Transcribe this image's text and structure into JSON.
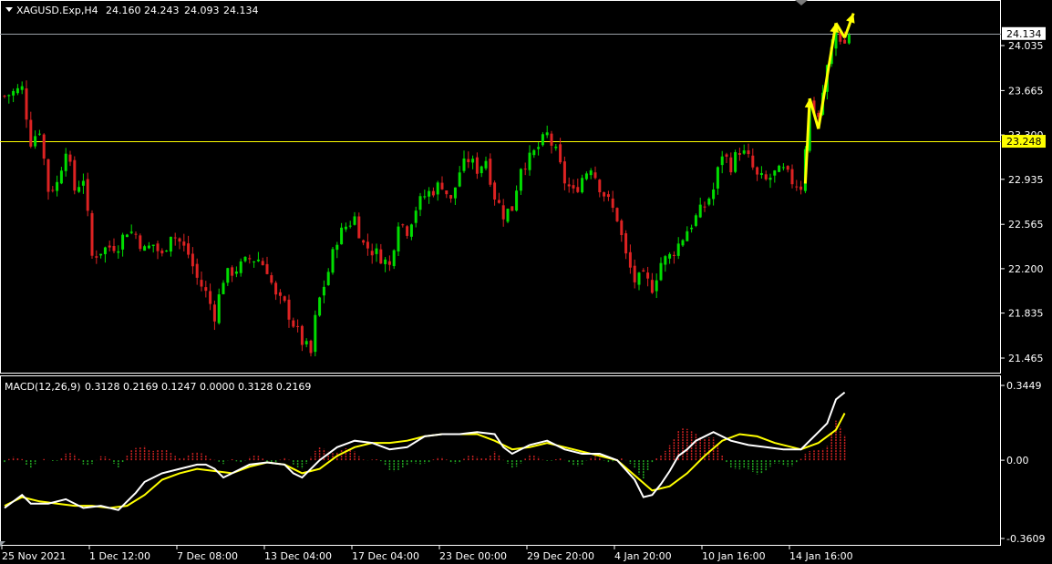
{
  "header": {
    "symbol": "XAGUSD.Exp,H4",
    "open": "24.160",
    "high": "24.243",
    "low": "24.093",
    "close": "24.134"
  },
  "macd_header": {
    "label": "MACD(12,26,9)",
    "values": "0.3128 0.2169 0.1247 0.0000 0.3128 0.2169"
  },
  "colors": {
    "background": "#000000",
    "bull": "#00dd00",
    "bear": "#dd2222",
    "frame": "#ffffff",
    "level_line": "#ffff00",
    "price_line": "#9aa0a6",
    "macd_line": "#ffffff",
    "signal_line": "#ffff00",
    "hist_pos": "#cc2222",
    "hist_neg": "#22aa22",
    "arrow": "#ffff00"
  },
  "chart_data": [
    {
      "type": "candlestick",
      "title": "XAGUSD.Exp,H4",
      "price_ticks": [
        "24.035",
        "23.665",
        "23.300",
        "22.935",
        "22.565",
        "22.200",
        "21.835",
        "21.465"
      ],
      "current_price": "24.134",
      "level": "23.248",
      "ylim": [
        21.25,
        24.5
      ],
      "x_labels": [
        "25 Nov 2021",
        "1 Dec 12:00",
        "7 Dec 08:00",
        "13 Dec 04:00",
        "17 Dec 04:00",
        "23 Dec 00:00",
        "29 Dec 20:00",
        "4 Jan 20:00",
        "10 Jan 16:00",
        "14 Jan 16:00"
      ],
      "close_path": [
        [
          0,
          23.62
        ],
        [
          4,
          23.68
        ],
        [
          6,
          23.25
        ],
        [
          8,
          23.35
        ],
        [
          10,
          22.85
        ],
        [
          12,
          22.9
        ],
        [
          14,
          23.2
        ],
        [
          16,
          22.85
        ],
        [
          18,
          22.95
        ],
        [
          20,
          22.3
        ],
        [
          22,
          22.35
        ],
        [
          24,
          22.38
        ],
        [
          26,
          22.4
        ],
        [
          28,
          22.52
        ],
        [
          30,
          22.48
        ],
        [
          32,
          22.35
        ],
        [
          34,
          22.4
        ],
        [
          36,
          22.3
        ],
        [
          38,
          22.5
        ],
        [
          40,
          22.42
        ],
        [
          42,
          22.32
        ],
        [
          44,
          22.12
        ],
        [
          46,
          22.0
        ],
        [
          48,
          21.82
        ],
        [
          50,
          22.12
        ],
        [
          52,
          22.18
        ],
        [
          54,
          22.22
        ],
        [
          56,
          22.28
        ],
        [
          58,
          22.28
        ],
        [
          60,
          22.2
        ],
        [
          62,
          21.96
        ],
        [
          64,
          21.9
        ],
        [
          66,
          21.75
        ],
        [
          68,
          21.6
        ],
        [
          70,
          21.5
        ],
        [
          71,
          21.78
        ],
        [
          72,
          21.95
        ],
        [
          74,
          22.18
        ],
        [
          76,
          22.45
        ],
        [
          78,
          22.55
        ],
        [
          80,
          22.62
        ],
        [
          82,
          22.4
        ],
        [
          84,
          22.35
        ],
        [
          86,
          22.3
        ],
        [
          88,
          22.22
        ],
        [
          90,
          22.6
        ],
        [
          92,
          22.52
        ],
        [
          94,
          22.7
        ],
        [
          96,
          22.8
        ],
        [
          98,
          22.85
        ],
        [
          100,
          22.9
        ],
        [
          102,
          22.75
        ],
        [
          104,
          23.0
        ],
        [
          106,
          23.1
        ],
        [
          108,
          23.02
        ],
        [
          110,
          23.1
        ],
        [
          112,
          22.8
        ],
        [
          114,
          22.65
        ],
        [
          116,
          22.7
        ],
        [
          118,
          23.05
        ],
        [
          120,
          23.1
        ],
        [
          122,
          23.2
        ],
        [
          124,
          23.3
        ],
        [
          126,
          23.15
        ],
        [
          128,
          22.92
        ],
        [
          130,
          22.82
        ],
        [
          132,
          22.95
        ],
        [
          134,
          23.05
        ],
        [
          136,
          22.88
        ],
        [
          138,
          22.75
        ],
        [
          140,
          22.62
        ],
        [
          142,
          22.3
        ],
        [
          144,
          22.1
        ],
        [
          146,
          22.12
        ],
        [
          148,
          22.05
        ],
        [
          150,
          22.25
        ],
        [
          152,
          22.3
        ],
        [
          154,
          22.4
        ],
        [
          156,
          22.52
        ],
        [
          158,
          22.62
        ],
        [
          160,
          22.72
        ],
        [
          162,
          22.85
        ],
        [
          164,
          23.15
        ],
        [
          166,
          23.05
        ],
        [
          168,
          23.18
        ],
        [
          170,
          23.1
        ],
        [
          172,
          22.95
        ],
        [
          174,
          22.92
        ],
        [
          176,
          22.98
        ],
        [
          178,
          23.0
        ],
        [
          180,
          22.92
        ],
        [
          182,
          22.88
        ],
        [
          184,
          23.55
        ],
        [
          186,
          23.45
        ],
        [
          188,
          23.85
        ],
        [
          190,
          24.15
        ],
        [
          192,
          24.05
        ],
        [
          193,
          24.134
        ]
      ],
      "arrow_path": [
        [
          183,
          22.9
        ],
        [
          184,
          23.6
        ],
        [
          186,
          23.35
        ],
        [
          190,
          24.22
        ],
        [
          192,
          24.1
        ],
        [
          194,
          24.3
        ]
      ]
    },
    {
      "type": "macd",
      "title": "MACD(12,26,9)",
      "ticks": [
        "0.3449",
        "0.00",
        "-0.3609"
      ],
      "ylim": [
        -0.3609,
        0.3449
      ],
      "macd_path": [
        [
          0,
          -0.22
        ],
        [
          4,
          -0.16
        ],
        [
          6,
          -0.2
        ],
        [
          10,
          -0.2
        ],
        [
          14,
          -0.18
        ],
        [
          18,
          -0.22
        ],
        [
          22,
          -0.21
        ],
        [
          26,
          -0.23
        ],
        [
          30,
          -0.15
        ],
        [
          32,
          -0.1
        ],
        [
          36,
          -0.06
        ],
        [
          40,
          -0.04
        ],
        [
          44,
          -0.02
        ],
        [
          46,
          -0.02
        ],
        [
          48,
          -0.04
        ],
        [
          50,
          -0.08
        ],
        [
          52,
          -0.06
        ],
        [
          56,
          -0.02
        ],
        [
          60,
          -0.01
        ],
        [
          64,
          -0.02
        ],
        [
          66,
          -0.06
        ],
        [
          68,
          -0.08
        ],
        [
          72,
          0.0
        ],
        [
          76,
          0.06
        ],
        [
          80,
          0.09
        ],
        [
          84,
          0.08
        ],
        [
          88,
          0.05
        ],
        [
          92,
          0.06
        ],
        [
          96,
          0.11
        ],
        [
          100,
          0.12
        ],
        [
          104,
          0.12
        ],
        [
          108,
          0.13
        ],
        [
          112,
          0.12
        ],
        [
          114,
          0.06
        ],
        [
          116,
          0.03
        ],
        [
          120,
          0.07
        ],
        [
          124,
          0.09
        ],
        [
          128,
          0.05
        ],
        [
          132,
          0.03
        ],
        [
          136,
          0.03
        ],
        [
          140,
          0.0
        ],
        [
          144,
          -0.09
        ],
        [
          146,
          -0.17
        ],
        [
          148,
          -0.16
        ],
        [
          150,
          -0.11
        ],
        [
          152,
          -0.05
        ],
        [
          154,
          0.02
        ],
        [
          156,
          0.05
        ],
        [
          158,
          0.09
        ],
        [
          162,
          0.13
        ],
        [
          166,
          0.09
        ],
        [
          170,
          0.07
        ],
        [
          174,
          0.06
        ],
        [
          178,
          0.05
        ],
        [
          180,
          0.05
        ],
        [
          182,
          0.05
        ],
        [
          184,
          0.09
        ],
        [
          186,
          0.13
        ],
        [
          188,
          0.17
        ],
        [
          190,
          0.28
        ],
        [
          192,
          0.3128
        ]
      ],
      "signal_path": [
        [
          0,
          -0.21
        ],
        [
          4,
          -0.17
        ],
        [
          8,
          -0.19
        ],
        [
          12,
          -0.2
        ],
        [
          16,
          -0.21
        ],
        [
          20,
          -0.21
        ],
        [
          24,
          -0.22
        ],
        [
          28,
          -0.21
        ],
        [
          32,
          -0.16
        ],
        [
          36,
          -0.09
        ],
        [
          40,
          -0.06
        ],
        [
          44,
          -0.04
        ],
        [
          48,
          -0.05
        ],
        [
          52,
          -0.06
        ],
        [
          56,
          -0.03
        ],
        [
          60,
          -0.01
        ],
        [
          64,
          -0.02
        ],
        [
          68,
          -0.06
        ],
        [
          72,
          -0.04
        ],
        [
          76,
          0.02
        ],
        [
          80,
          0.06
        ],
        [
          84,
          0.08
        ],
        [
          88,
          0.08
        ],
        [
          92,
          0.09
        ],
        [
          96,
          0.11
        ],
        [
          100,
          0.12
        ],
        [
          104,
          0.12
        ],
        [
          108,
          0.12
        ],
        [
          112,
          0.09
        ],
        [
          116,
          0.05
        ],
        [
          120,
          0.06
        ],
        [
          124,
          0.08
        ],
        [
          128,
          0.06
        ],
        [
          132,
          0.04
        ],
        [
          136,
          0.02
        ],
        [
          140,
          0.0
        ],
        [
          144,
          -0.07
        ],
        [
          148,
          -0.14
        ],
        [
          152,
          -0.12
        ],
        [
          156,
          -0.06
        ],
        [
          160,
          0.02
        ],
        [
          164,
          0.09
        ],
        [
          168,
          0.12
        ],
        [
          172,
          0.11
        ],
        [
          176,
          0.08
        ],
        [
          180,
          0.06
        ],
        [
          182,
          0.05
        ],
        [
          186,
          0.08
        ],
        [
          190,
          0.14
        ],
        [
          192,
          0.2169
        ]
      ]
    }
  ]
}
